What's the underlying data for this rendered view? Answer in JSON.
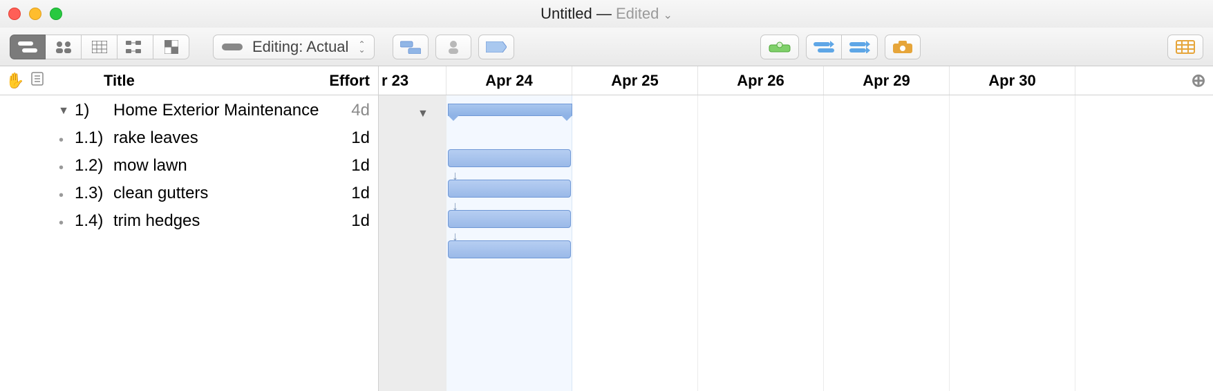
{
  "window": {
    "title": "Untitled",
    "edited_label": "Edited"
  },
  "toolbar": {
    "editing_label": "Editing: Actual"
  },
  "columns": {
    "title_label": "Title",
    "effort_label": "Effort"
  },
  "timeline": {
    "partial_date": "r 23",
    "dates": [
      "Apr 24",
      "Apr 25",
      "Apr 26",
      "Apr 29",
      "Apr 30"
    ]
  },
  "tasks": {
    "parent": {
      "num": "1)",
      "title": "Home Exterior Maintenance",
      "effort": "4d"
    },
    "children": [
      {
        "num": "1.1)",
        "title": "rake leaves",
        "effort": "1d"
      },
      {
        "num": "1.2)",
        "title": "mow lawn",
        "effort": "1d"
      },
      {
        "num": "1.3)",
        "title": "clean gutters",
        "effort": "1d"
      },
      {
        "num": "1.4)",
        "title": "trim hedges",
        "effort": "1d"
      }
    ]
  }
}
